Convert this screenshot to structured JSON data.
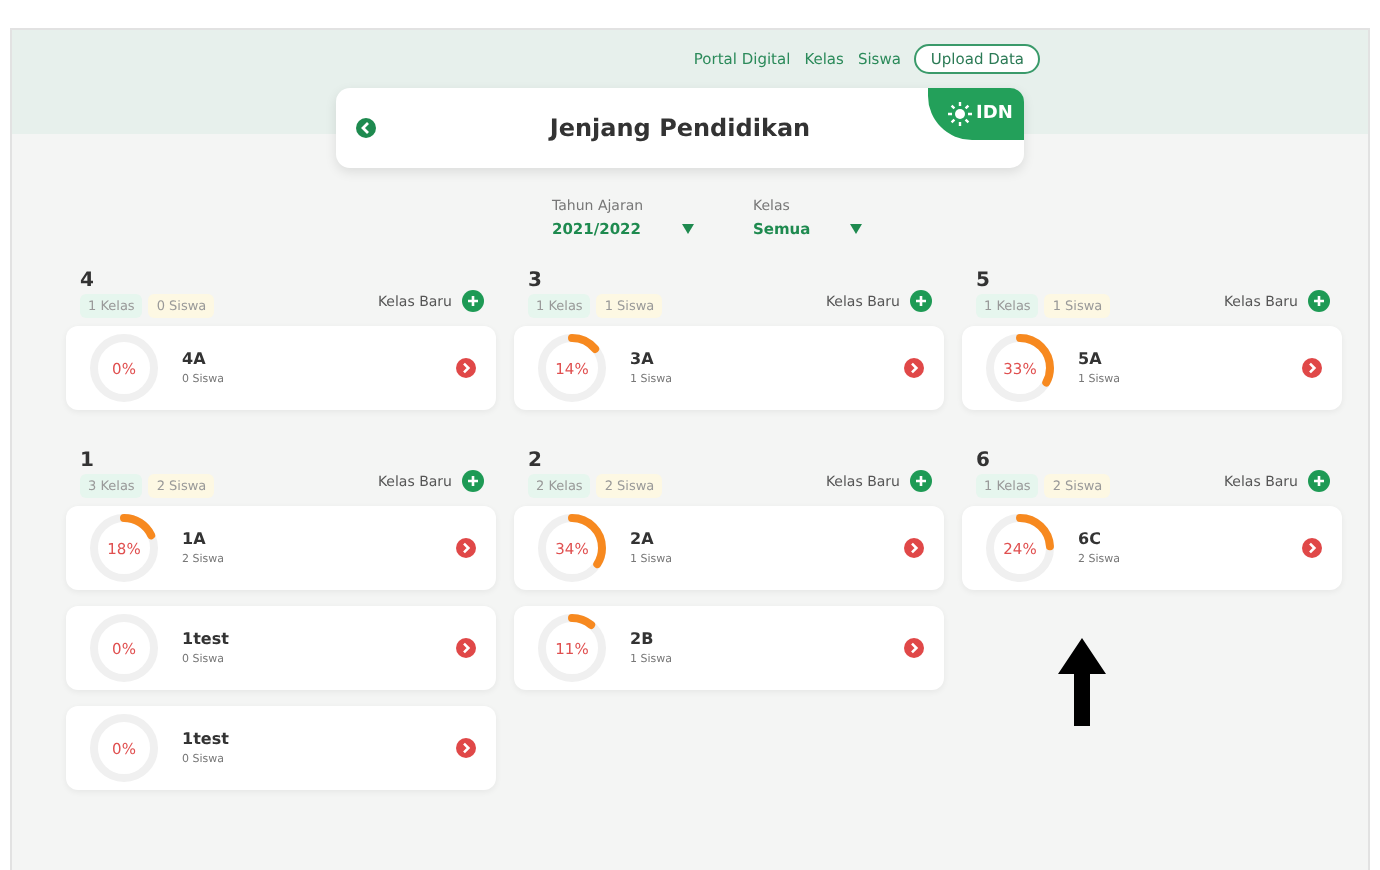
{
  "nav": {
    "links": [
      "Portal Digital",
      "Kelas",
      "Siswa"
    ],
    "button": "Upload Data"
  },
  "header": {
    "title": "Jenjang Pendidikan",
    "logo_text": "IDN"
  },
  "filters": [
    {
      "label": "Tahun Ajaran",
      "value": "2021/2022"
    },
    {
      "label": "Kelas",
      "value": "Semua"
    }
  ],
  "groups": [
    {
      "level": "4",
      "class_count": "1 Kelas",
      "student_count": "0 Siswa",
      "add_label": "Kelas Baru",
      "classes": [
        {
          "percent": "0%",
          "name": "4A",
          "students": "0 Siswa"
        }
      ]
    },
    {
      "level": "3",
      "class_count": "1 Kelas",
      "student_count": "1 Siswa",
      "add_label": "Kelas Baru",
      "classes": [
        {
          "percent": "14%",
          "name": "3A",
          "students": "1 Siswa"
        }
      ]
    },
    {
      "level": "5",
      "class_count": "1 Kelas",
      "student_count": "1 Siswa",
      "add_label": "Kelas Baru",
      "classes": [
        {
          "percent": "33%",
          "name": "5A",
          "students": "1 Siswa"
        }
      ]
    },
    {
      "level": "1",
      "class_count": "3 Kelas",
      "student_count": "2 Siswa",
      "add_label": "Kelas Baru",
      "classes": [
        {
          "percent": "18%",
          "name": "1A",
          "students": "2 Siswa"
        },
        {
          "percent": "0%",
          "name": "1test",
          "students": "0 Siswa"
        },
        {
          "percent": "0%",
          "name": "1test",
          "students": "0 Siswa"
        }
      ]
    },
    {
      "level": "2",
      "class_count": "2 Kelas",
      "student_count": "2 Siswa",
      "add_label": "Kelas Baru",
      "classes": [
        {
          "percent": "34%",
          "name": "2A",
          "students": "1 Siswa"
        },
        {
          "percent": "11%",
          "name": "2B",
          "students": "1 Siswa"
        }
      ]
    },
    {
      "level": "6",
      "class_count": "1 Kelas",
      "student_count": "2 Siswa",
      "add_label": "Kelas Baru",
      "classes": [
        {
          "percent": "24%",
          "name": "6C",
          "students": "2 Siswa"
        }
      ]
    }
  ]
}
